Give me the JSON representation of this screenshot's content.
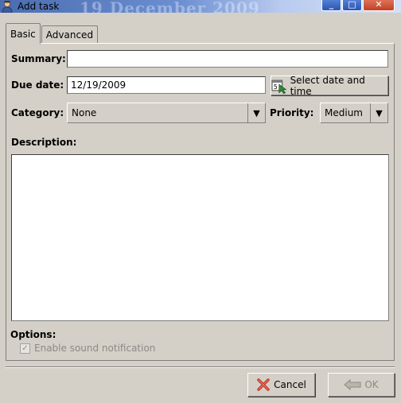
{
  "window": {
    "title": "Add task",
    "background_text": "19 December 2009"
  },
  "tabs": [
    {
      "label": "Basic",
      "active": true
    },
    {
      "label": "Advanced",
      "active": false
    }
  ],
  "form": {
    "summary_label": "Summary:",
    "summary_value": "",
    "due_date_label": "Due date:",
    "due_date_value": "12/19/2009",
    "select_date_button": "Select date and time",
    "category_label": "Category:",
    "category_value": "None",
    "priority_label": "Priority:",
    "priority_value": "Medium",
    "description_label": "Description:",
    "description_value": "",
    "options_label": "Options:",
    "sound_notification_label": "Enable sound notification",
    "sound_notification_checked": true
  },
  "footer": {
    "cancel_label": "Cancel",
    "ok_label": "OK"
  },
  "colors": {
    "window_bg": "#d4d0c8",
    "cancel_icon": "#c0392b",
    "disabled_text": "#8c8a85"
  },
  "icons": {
    "title": "user-icon",
    "calendar": "calendar-icon",
    "cancel": "x-icon",
    "ok": "arrow-left-icon"
  }
}
